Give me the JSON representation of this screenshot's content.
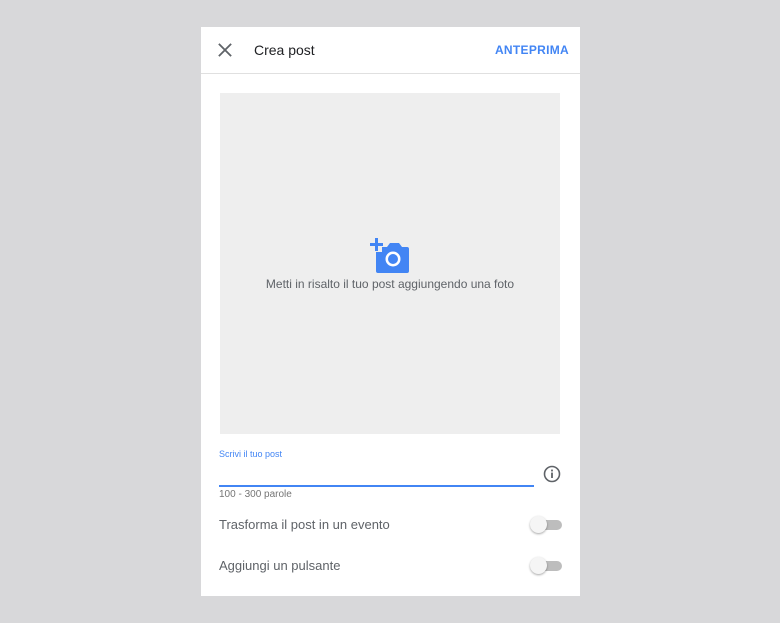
{
  "header": {
    "title": "Crea post",
    "preview_label": "ANTEPRIMA"
  },
  "photo": {
    "hint": "Metti in risalto il tuo post aggiungendo una foto",
    "icon": "add-photo-icon"
  },
  "post_input": {
    "label": "Scrivi il tuo post",
    "value": "",
    "hint": "100 - 300 parole",
    "info_icon": "info-icon"
  },
  "options": [
    {
      "label": "Trasforma il post in un evento",
      "enabled": false
    },
    {
      "label": "Aggiungi un pulsante",
      "enabled": false
    }
  ],
  "colors": {
    "accent": "#4285f4",
    "background": "#d8d8da",
    "panel": "#ffffff",
    "photo_area": "#eeeeee"
  }
}
